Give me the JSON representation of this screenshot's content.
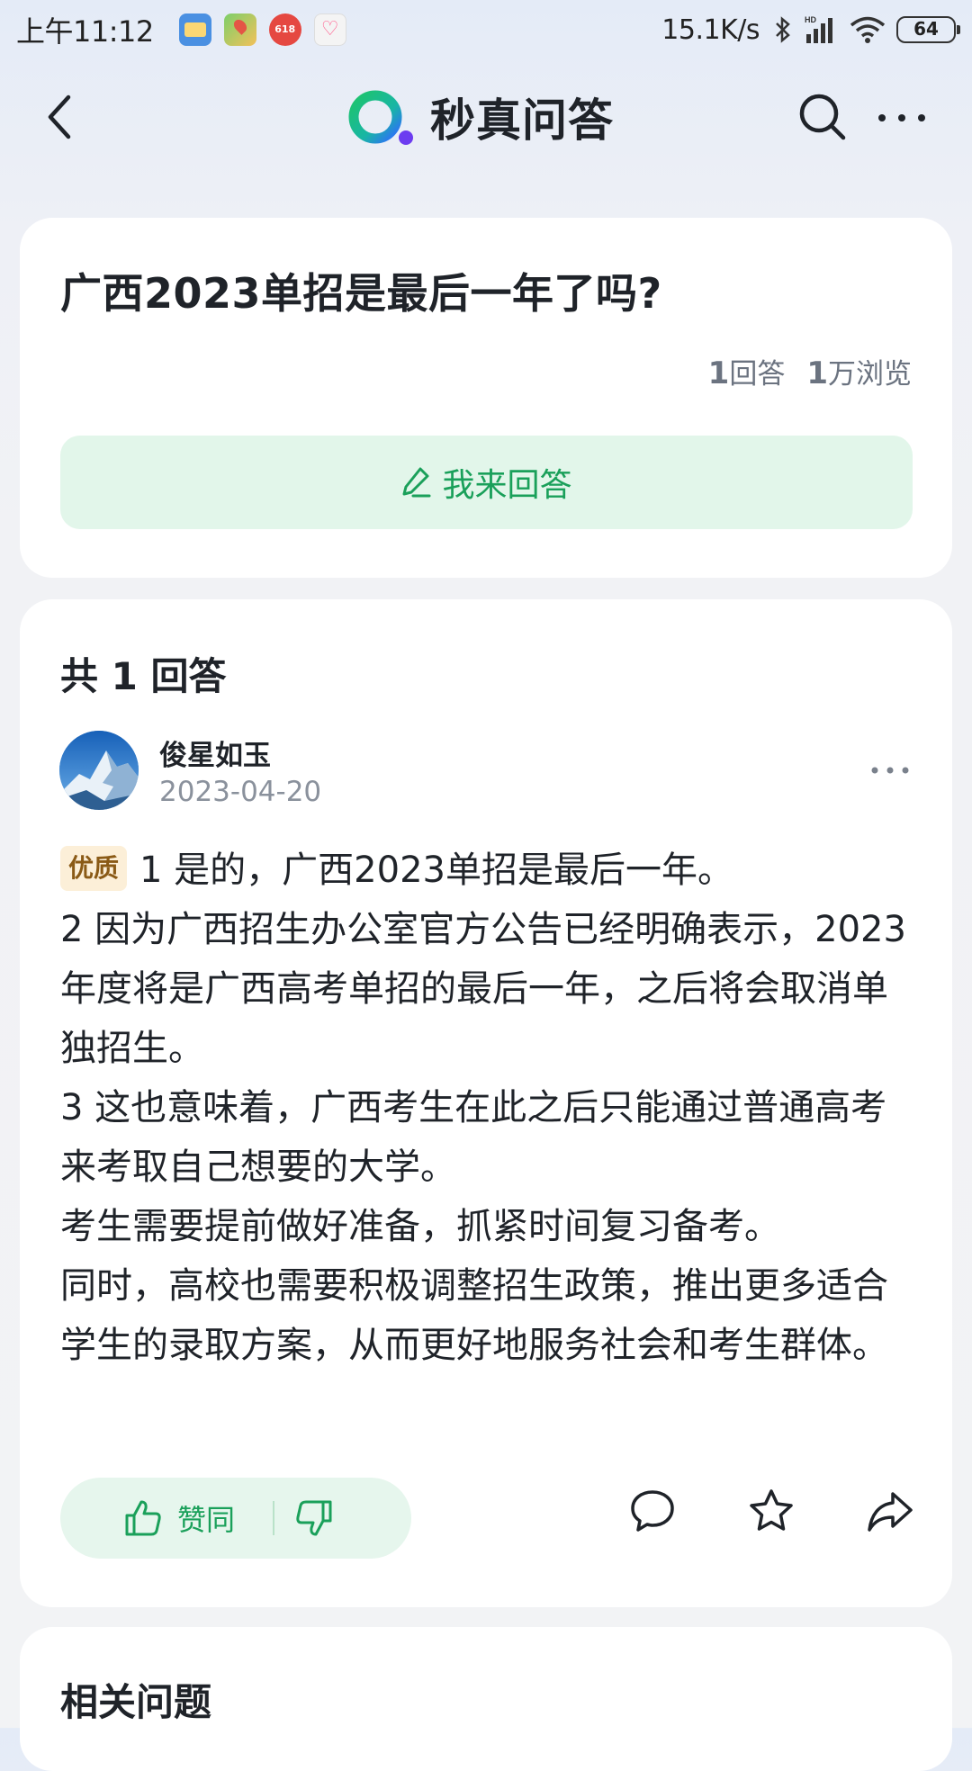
{
  "status_bar": {
    "time": "上午11:12",
    "net_speed": "15.1K/s",
    "battery": "64",
    "app_icons": [
      "calendar-app-icon",
      "maps-app-icon",
      "618-promo-app-icon",
      "health-app-icon"
    ],
    "promo_badge": "618"
  },
  "nav": {
    "brand": "秒真问答",
    "brand_colors": {
      "green": "#1ec46b",
      "blue": "#2f6bff",
      "purple": "#6c3cf0"
    }
  },
  "question": {
    "title": "广西2023单招是最后一年了吗?",
    "answers_count": "1",
    "answers_label": "回答",
    "views_count": "1",
    "views_label": "万浏览",
    "answer_button": "我来回答"
  },
  "answers": {
    "header": "共 1 回答",
    "items": [
      {
        "author": "俊星如玉",
        "date": "2023-04-20",
        "badge": "优质",
        "paragraphs": [
          "1 是的，广西2023单招是最后一年。",
          "2 因为广西招生办公室官方公告已经明确表示，2023年度将是广西高考单招的最后一年，之后将会取消单独招生。",
          "3 这也意味着，广西考生在此之后只能通过普通高考来考取自己想要的大学。",
          "考生需要提前做好准备，抓紧时间复习备考。",
          "同时，高校也需要积极调整招生政策，推出更多适合学生的录取方案，从而更好地服务社会和考生群体。"
        ],
        "agree_label": "赞同"
      }
    ]
  },
  "related": {
    "title": "相关问题"
  },
  "colors": {
    "accent_green": "#1aa05a",
    "answer_btn_bg": "#e2f6ea",
    "badge_bg": "#fcefd8",
    "badge_text": "#8a5a16"
  }
}
